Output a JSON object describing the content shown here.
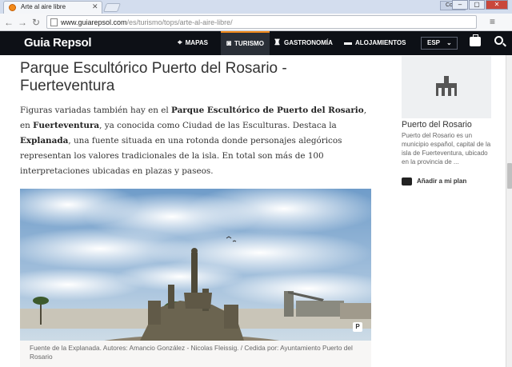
{
  "browser": {
    "tab_title": "Arte al aire libre",
    "tab_close": "✕",
    "user_label": "Colas",
    "window_buttons": [
      "–",
      "▢",
      "✕"
    ],
    "url_host": "www.guiarepsol.com",
    "url_path": "/es/turismo/tops/arte-al-aire-libre/"
  },
  "site": {
    "logo": "Guia Repsol",
    "nav": [
      {
        "label": "MAPAS",
        "icon": "map-pin-icon"
      },
      {
        "label": "TURISMO",
        "icon": "camera-icon"
      },
      {
        "label": "GASTRONOMÍA",
        "icon": "chef-hat-icon"
      },
      {
        "label": "ALOJAMIENTOS",
        "icon": "bed-icon"
      }
    ],
    "active_nav": "TURISMO",
    "language": "ESP",
    "accent_color": "#f28a1a"
  },
  "article": {
    "title": "Parque Escultórico Puerto del Rosario - Fuerteventura",
    "body": [
      {
        "t": "Figuras variadas también hay en el ",
        "b": false
      },
      {
        "t": "Parque Escultórico de Puerto del Rosario",
        "b": true
      },
      {
        "t": ", en ",
        "b": false
      },
      {
        "t": "Fuerteventura",
        "b": true
      },
      {
        "t": ", ya conocida como Ciudad de las Esculturas. Destaca la ",
        "b": false
      },
      {
        "t": "Explanada",
        "b": true
      },
      {
        "t": ", una fuente situada en una rotonda donde personajes alegóricos representan los valores tradicionales de la isla. En total son más de 100 interpretaciones ubicadas en plazas y paseos.",
        "b": false
      }
    ],
    "caption": "Fuente de la Explanada. Autores: Amancio González - Nicolas Fleissig. / Cedida por: Ayuntamiento Puerto del Rosario",
    "pin_label": "P"
  },
  "sidebar": {
    "title": "Puerto del Rosario",
    "description": "Puerto del Rosario es un municipio español, capital de la isla de Fuerteventura, ubicado en la provincia de ...",
    "add_plan": "Añadir a mi plan"
  }
}
